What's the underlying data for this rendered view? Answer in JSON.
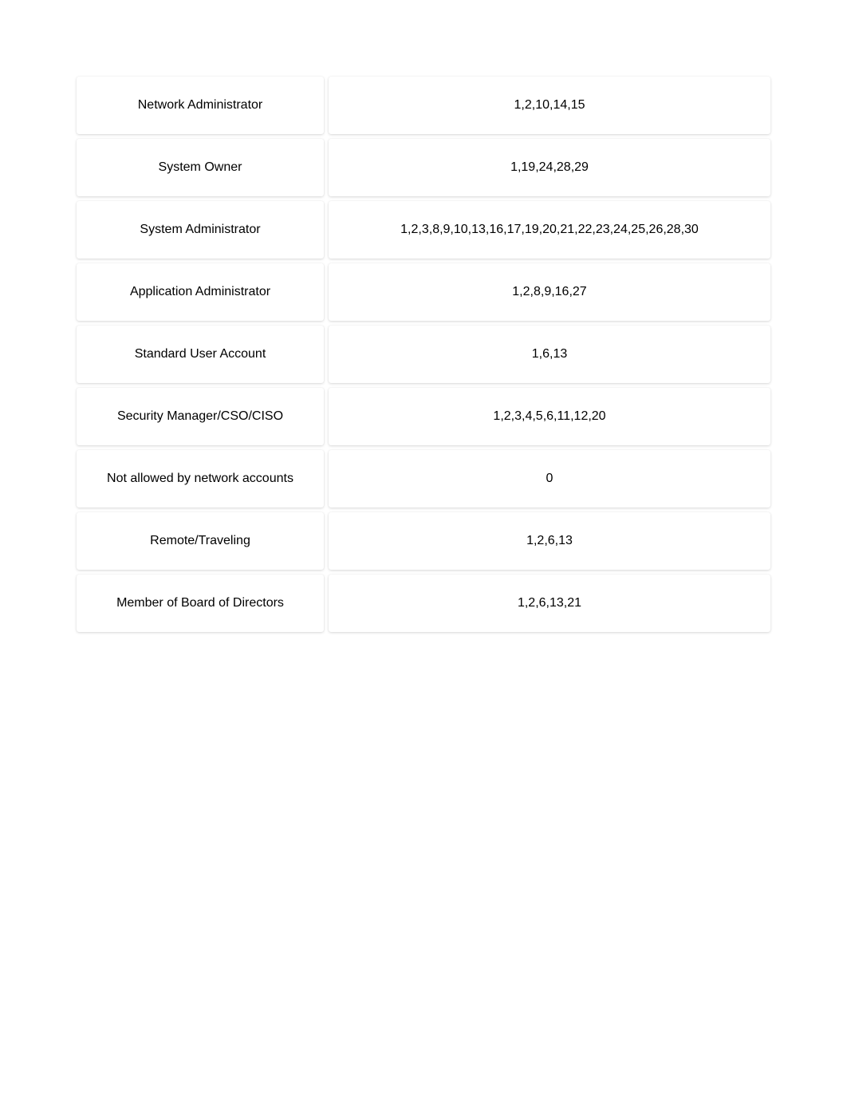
{
  "table": {
    "rows": [
      {
        "role": "Network Administrator",
        "values": "1,2,10,14,15"
      },
      {
        "role": "System Owner",
        "values": "1,19,24,28,29"
      },
      {
        "role": "System Administrator",
        "values": "1,2,3,8,9,10,13,16,17,19,20,21,22,23,24,25,26,28,30"
      },
      {
        "role": "Application Administrator",
        "values": "1,2,8,9,16,27"
      },
      {
        "role": "Standard User Account",
        "values": "1,6,13"
      },
      {
        "role": "Security Manager/CSO/CISO",
        "values": "1,2,3,4,5,6,11,12,20"
      },
      {
        "role": "Not allowed by network accounts",
        "values": "0"
      },
      {
        "role": "Remote/Traveling",
        "values": "1,2,6,13"
      },
      {
        "role": "Member of Board of Directors",
        "values": "1,2,6,13,21"
      }
    ]
  }
}
